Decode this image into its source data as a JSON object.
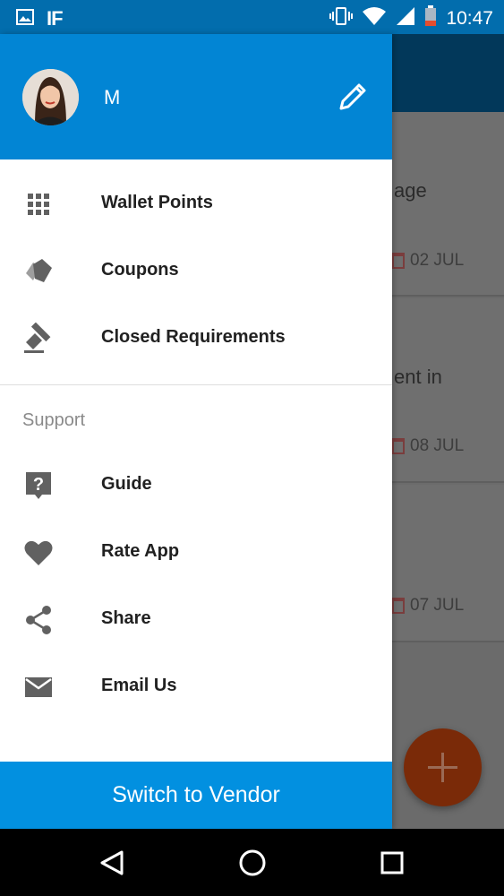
{
  "status_bar": {
    "time": "10:47",
    "left_icons": [
      "image-icon",
      "if-logo"
    ],
    "if_label": "IF",
    "right_icons": [
      "vibrate-icon",
      "wifi-icon",
      "signal-icon",
      "battery-icon"
    ]
  },
  "drawer": {
    "user_name": "M",
    "menu": [
      {
        "label": "Wallet Points",
        "icon": "grid-icon"
      },
      {
        "label": "Coupons",
        "icon": "tag-icon"
      },
      {
        "label": "Closed Requirements",
        "icon": "gavel-icon"
      }
    ],
    "support": {
      "title": "Support",
      "items": [
        {
          "label": "Guide",
          "icon": "help-icon"
        },
        {
          "label": "Rate App",
          "icon": "heart-icon"
        },
        {
          "label": "Share",
          "icon": "share-icon"
        },
        {
          "label": "Email Us",
          "icon": "email-icon"
        }
      ]
    },
    "switch_button": "Switch to Vendor"
  },
  "background": {
    "cards": [
      {
        "text": "age",
        "date": "02 JUL"
      },
      {
        "text": "ent in",
        "date": "08 JUL"
      },
      {
        "text": "",
        "date": "07 JUL"
      }
    ]
  },
  "colors": {
    "primary": "#0285d4",
    "status_bar": "#026dad",
    "switch_button": "#0290e0",
    "fab": "#7a2a08"
  }
}
